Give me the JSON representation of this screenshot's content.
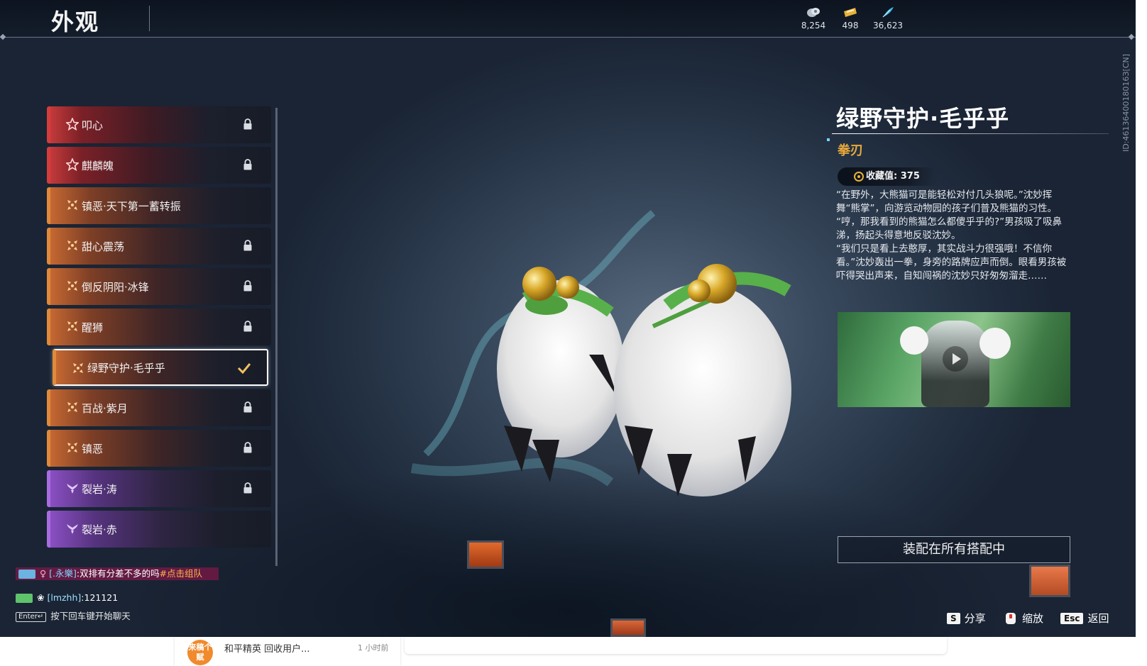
{
  "header": {
    "title": "外观",
    "currencies": [
      {
        "icon": "silver-coin-icon",
        "value": "8,254"
      },
      {
        "icon": "gold-ticket-icon",
        "value": "498"
      },
      {
        "icon": "feather-icon",
        "value": "36,623"
      }
    ]
  },
  "uid": "ID:4613640018016З[CN]",
  "list": {
    "items": [
      {
        "label": "叩心",
        "rarity": "red",
        "state": "locked"
      },
      {
        "label": "麒麟魄",
        "rarity": "red",
        "state": "locked"
      },
      {
        "label": "镇恶·天下第一蓄转振",
        "rarity": "orange",
        "state": "none"
      },
      {
        "label": "甜心震荡",
        "rarity": "orange",
        "state": "locked"
      },
      {
        "label": "倒反阴阳·冰锋",
        "rarity": "orange",
        "state": "locked"
      },
      {
        "label": "醒狮",
        "rarity": "orange",
        "state": "locked"
      },
      {
        "label": "绿野守护·毛乎乎",
        "rarity": "orange",
        "state": "selected"
      },
      {
        "label": "百战·紫月",
        "rarity": "orange",
        "state": "locked"
      },
      {
        "label": "镇恶",
        "rarity": "orange",
        "state": "locked"
      },
      {
        "label": "裂岩·涛",
        "rarity": "purple",
        "state": "locked"
      },
      {
        "label": "裂岩·赤",
        "rarity": "purple",
        "state": "none"
      }
    ]
  },
  "detail": {
    "name": "绿野守护·毛乎乎",
    "type": "拳刃",
    "collect_label": "收藏值: 375",
    "description": [
      "“在野外，大熊猫可是能轻松对付几头狼呢。”沈妙挥舞“熊掌”，向游览动物园的孩子们普及熊猫的习性。",
      "“哼，那我看到的熊猫怎么都傻乎乎的?”男孩吸了吸鼻涕，扬起头得意地反驳沈妙。",
      "“我们只是看上去憨厚，其实战斗力很强哦！不信你看。”沈妙轰出一拳，身旁的路牌应声而倒。眼看男孩被吓得哭出声来，自知闯祸的沈妙只好匆匆溜走……"
    ],
    "equip_label": "装配在所有搭配中"
  },
  "chat": {
    "line1_name": "[.永樂]",
    "line1_text": ":双排有分差不多的吗",
    "line1_link": "#点击组队",
    "line2_name": "[lmzhh]",
    "line2_text": ":121121",
    "enter_key": "Enter↵",
    "enter_hint": "按下回车键开始聊天"
  },
  "hints": [
    {
      "key": "S",
      "label": "分享"
    },
    {
      "key": "",
      "label": "缩放"
    },
    {
      "key": "Esc",
      "label": "返回"
    }
  ],
  "below": {
    "avatar_text": "来稿个赋",
    "title": "和平精英 回收用户...",
    "time": "1 小时前"
  },
  "colors": {
    "accent_orange": "#e8a93c",
    "rarity_red": "#d63c3c",
    "rarity_orange": "#e08a3a",
    "rarity_purple": "#a86ce0"
  }
}
